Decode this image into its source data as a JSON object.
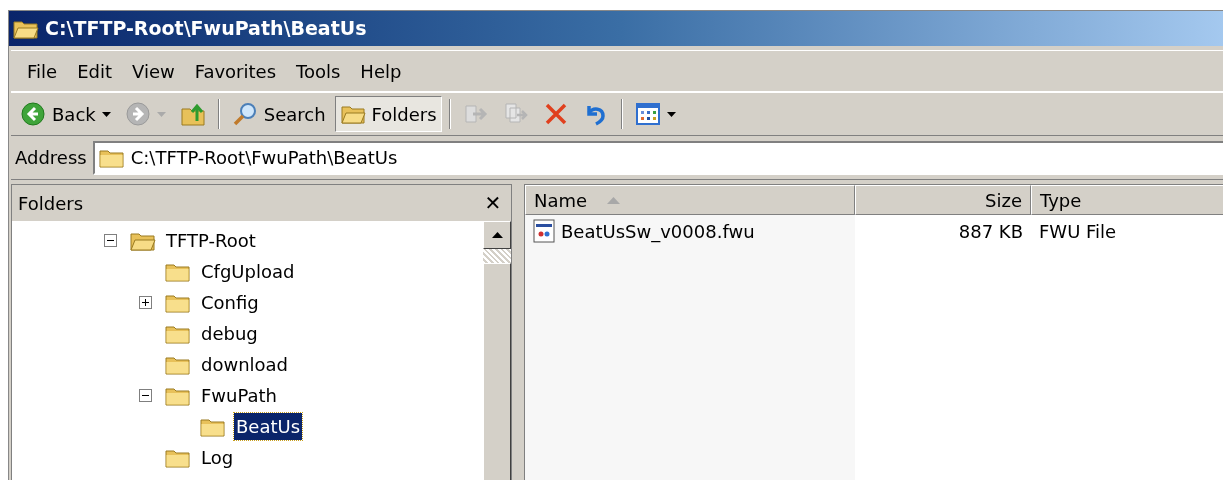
{
  "window": {
    "title": "C:\\TFTP-Root\\FwuPath\\BeatUs"
  },
  "menu": [
    "File",
    "Edit",
    "View",
    "Favorites",
    "Tools",
    "Help"
  ],
  "toolbar": [
    {
      "label": "Back",
      "disabled": false,
      "selected": false,
      "dropdown": true
    },
    {
      "disabled": true,
      "selected": false,
      "dropdown": true
    },
    {
      "disabled": false,
      "selected": false,
      "dropdown": false
    },
    {
      "label": "Search",
      "disabled": false,
      "selected": false,
      "dropdown": false
    },
    {
      "label": "Folders",
      "disabled": false,
      "selected": true,
      "dropdown": false
    },
    {
      "disabled": true,
      "selected": false,
      "dropdown": false
    },
    {
      "disabled": true,
      "selected": false,
      "dropdown": false
    },
    {
      "disabled": false,
      "selected": false,
      "dropdown": false
    },
    {
      "disabled": false,
      "selected": false,
      "dropdown": false
    },
    {
      "disabled": false,
      "selected": false,
      "dropdown": true
    }
  ],
  "address": {
    "label": "Address",
    "value": "C:\\TFTP-Root\\FwuPath\\BeatUs"
  },
  "folders_pane": {
    "title": "Folders",
    "close": "✕",
    "tree": [
      {
        "label": "TFTP-Root",
        "expanded": true,
        "selected": false,
        "children": [
          {
            "label": "CfgUpload",
            "selected": false
          },
          {
            "label": "Config",
            "expanded": false,
            "selected": false
          },
          {
            "label": "debug",
            "selected": false
          },
          {
            "label": "download",
            "selected": false
          },
          {
            "label": "FwuPath",
            "expanded": true,
            "selected": false,
            "children": [
              {
                "label": "BeatUs",
                "selected": true
              }
            ]
          },
          {
            "label": "Log",
            "selected": false
          }
        ]
      }
    ]
  },
  "file_list": {
    "columns": [
      {
        "label": "Name",
        "sorted": true
      },
      {
        "label": "Size",
        "sorted": false
      },
      {
        "label": "Type",
        "sorted": false
      }
    ],
    "rows": [
      {
        "name": "BeatUsSw_v0008.fwu",
        "size": "887 KB",
        "type": "FWU File"
      }
    ]
  }
}
